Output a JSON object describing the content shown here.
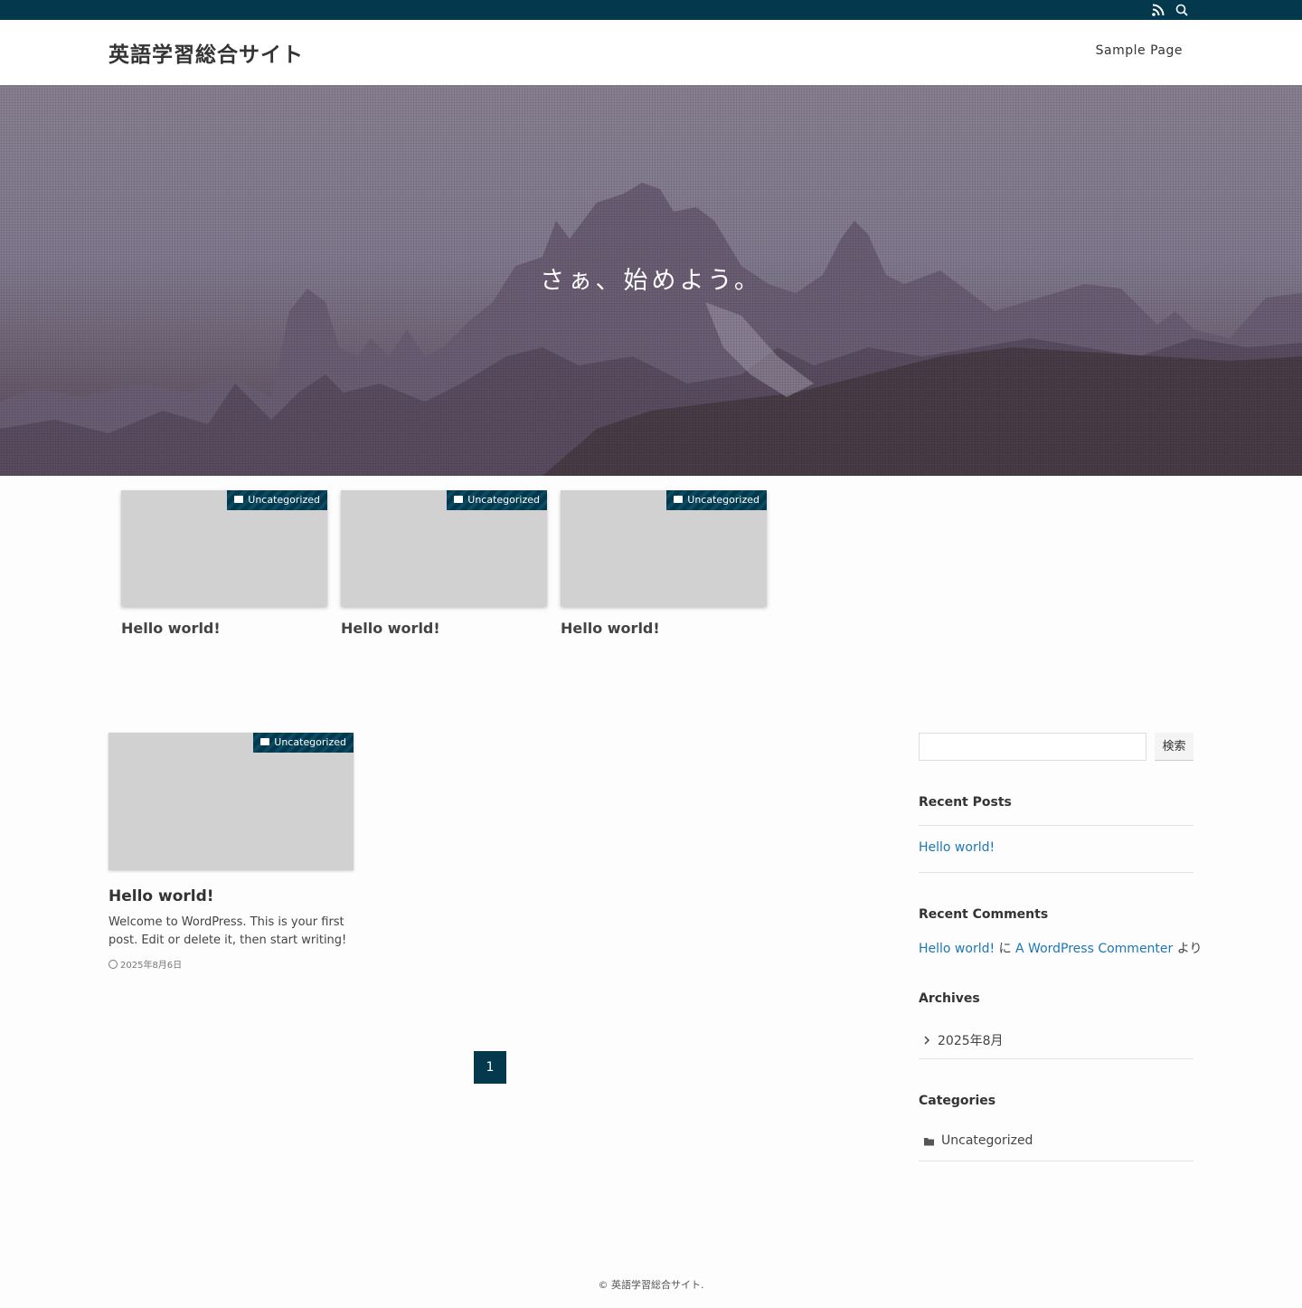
{
  "colors": {
    "accent": "#04384c",
    "link": "#1b76b5",
    "thumb": "#d1d1d1"
  },
  "topbar": {
    "icons": [
      "rss-icon",
      "search-icon"
    ]
  },
  "header": {
    "site_title": "英語学習総合サイト",
    "nav": {
      "sample_page": "Sample Page"
    }
  },
  "hero": {
    "catchphrase": "さぁ、始めよう。"
  },
  "pickup": [
    {
      "category": "Uncategorized",
      "title": "Hello world!"
    },
    {
      "category": "Uncategorized",
      "title": "Hello world!"
    },
    {
      "category": "Uncategorized",
      "title": "Hello world!"
    }
  ],
  "post": {
    "category": "Uncategorized",
    "title": "Hello world!",
    "excerpt_line1": "Welcome to WordPress. This is your first",
    "excerpt_line2": "post. Edit or delete it, then start writing!",
    "date": "2025年8月6日"
  },
  "pagination": {
    "current": "1"
  },
  "sidebar": {
    "search_button": "検索",
    "search_placeholder": "",
    "recent_posts": {
      "title": "Recent Posts",
      "items": [
        "Hello world!"
      ]
    },
    "recent_comments": {
      "title": "Recent Comments",
      "post": "Hello world!",
      "ni": "に",
      "author": "A WordPress Commenter",
      "yori": "より"
    },
    "archives": {
      "title": "Archives",
      "items": [
        "2025年8月"
      ]
    },
    "categories": {
      "title": "Categories",
      "items": [
        "Uncategorized"
      ]
    }
  },
  "footer": {
    "copyright": "© 英語学習総合サイト."
  }
}
